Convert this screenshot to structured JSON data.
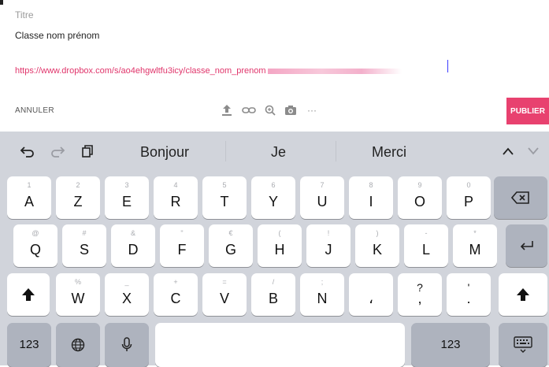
{
  "compose": {
    "title_label": "Titre",
    "title_value": "Classe nom prénom",
    "url_text": "https://www.dropbox.com/s/ao4ehgwltfu3icy/classe_nom_prenom",
    "cancel_label": "ANNULER",
    "publish_label": "PUBLIER",
    "tools": [
      "upload-icon",
      "link-icon",
      "zoom-icon",
      "camera-icon",
      "more-icon"
    ],
    "more_glyph": "···",
    "accent_color": "#e8416f"
  },
  "predictions": {
    "suggestions": [
      "Bonjour",
      "Je",
      "Merci"
    ]
  },
  "keyboard": {
    "row1": [
      {
        "main": "A",
        "sub": "1"
      },
      {
        "main": "Z",
        "sub": "2"
      },
      {
        "main": "E",
        "sub": "3"
      },
      {
        "main": "R",
        "sub": "4"
      },
      {
        "main": "T",
        "sub": "5"
      },
      {
        "main": "Y",
        "sub": "6"
      },
      {
        "main": "U",
        "sub": "7"
      },
      {
        "main": "I",
        "sub": "8"
      },
      {
        "main": "O",
        "sub": "9"
      },
      {
        "main": "P",
        "sub": "0"
      }
    ],
    "row2": [
      {
        "main": "Q",
        "sub": "@"
      },
      {
        "main": "S",
        "sub": "#"
      },
      {
        "main": "D",
        "sub": "&"
      },
      {
        "main": "F",
        "sub": "\""
      },
      {
        "main": "G",
        "sub": "€"
      },
      {
        "main": "H",
        "sub": "("
      },
      {
        "main": "J",
        "sub": "!"
      },
      {
        "main": "K",
        "sub": ")"
      },
      {
        "main": "L",
        "sub": "-"
      },
      {
        "main": "M",
        "sub": "*"
      }
    ],
    "row3": [
      {
        "main": "W",
        "sub": "%"
      },
      {
        "main": "X",
        "sub": "_"
      },
      {
        "main": "C",
        "sub": "+"
      },
      {
        "main": "V",
        "sub": "="
      },
      {
        "main": "B",
        "sub": "/"
      },
      {
        "main": "N",
        "sub": ";"
      },
      {
        "main": "،",
        "sub": ""
      },
      {
        "main": ",",
        "sub": "?"
      },
      {
        "main": ".",
        "sub": "'"
      }
    ],
    "numbers_label": "123"
  }
}
